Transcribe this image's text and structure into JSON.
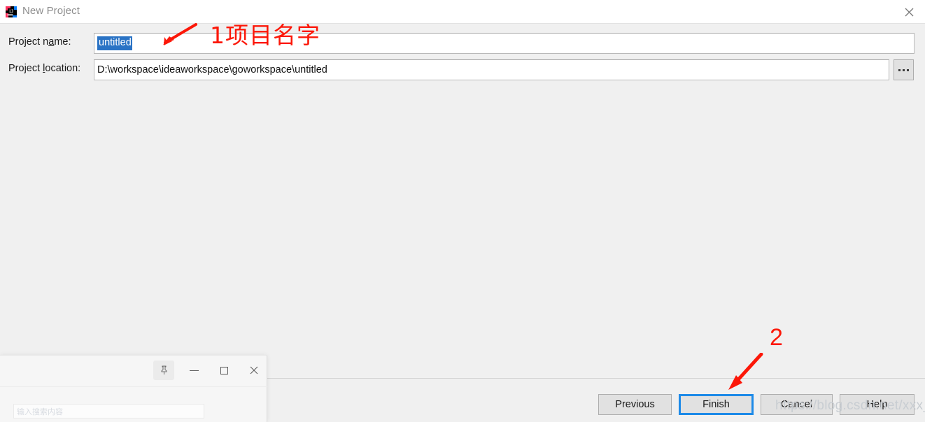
{
  "window": {
    "title": "New Project",
    "icon": "intellij-idea-logo",
    "close_icon": "close-icon"
  },
  "form": {
    "project_name": {
      "label_prefix": "Project n",
      "label_mnemonic": "a",
      "label_suffix": "me:",
      "value": "untitled",
      "selected": true,
      "selection_color": "#2a73c5"
    },
    "project_location": {
      "label_prefix": "Project ",
      "label_mnemonic": "l",
      "label_suffix": "ocation:",
      "value": "D:\\workspace\\ideaworkspace\\goworkspace\\untitled"
    },
    "browse_button": {
      "label": "...",
      "icon": "ellipsis-icon"
    }
  },
  "footer": {
    "buttons": [
      {
        "label": "Previous",
        "name": "previous-button",
        "focused": false
      },
      {
        "label": "Finish",
        "name": "finish-button",
        "focused": true
      },
      {
        "label": "Cancel",
        "name": "cancel-button",
        "focused": false
      },
      {
        "label": "Help",
        "name": "help-button",
        "focused": false
      }
    ],
    "focus_color": "#1d8ae8"
  },
  "annotations": {
    "color": "#fc1708",
    "step1_text": "1项目名字",
    "step2_text": "2",
    "arrow1": "red-arrow-pointing-left-down",
    "arrow2": "red-arrow-pointing-left-down"
  },
  "watermark": {
    "text": "https://blog.csdn.net/xxx_czj"
  },
  "overlay_window": {
    "pin_icon": "pin-icon",
    "minimize_icon": "minimize-icon",
    "maximize_icon": "maximize-icon",
    "close_icon": "close-icon",
    "input_text": "输入搜索内容"
  }
}
